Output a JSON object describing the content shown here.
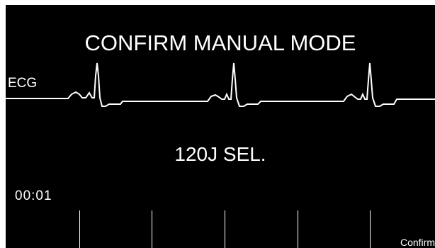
{
  "screen": {
    "title": "CONFIRM MANUAL MODE",
    "ecg_label": "ECG",
    "energy_selected": "120J SEL.",
    "elapsed_time": "00:01",
    "softkeys": [
      "",
      "",
      "",
      "",
      "Confirm"
    ]
  },
  "colors": {
    "background": "#000000",
    "foreground": "#ffffff"
  }
}
